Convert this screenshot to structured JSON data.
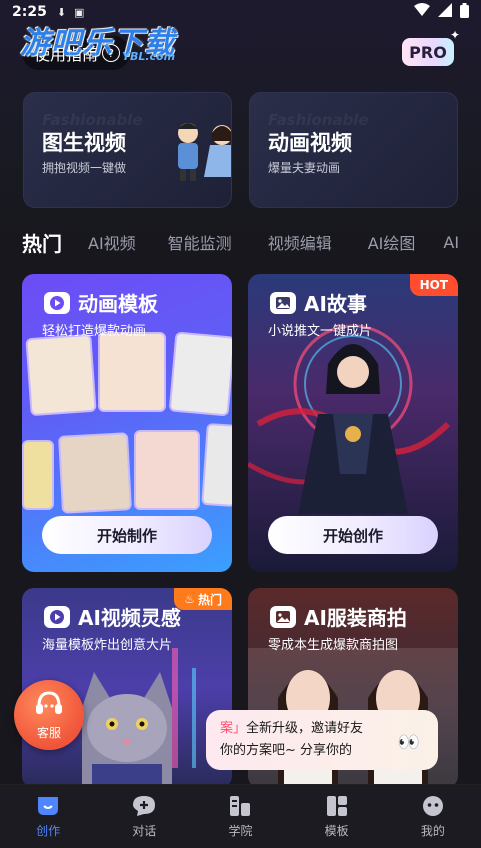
{
  "status": {
    "time": "2:25"
  },
  "watermark": {
    "title": "游吧乐下载",
    "sub": "YBL.com"
  },
  "header": {
    "guide_label": "使用指南",
    "pro_label": "PRO"
  },
  "features": [
    {
      "title": "图生视频",
      "subtitle": "拥抱视频一键做",
      "ghost": "Fashionable"
    },
    {
      "title": "动画视频",
      "subtitle": "爆量夫妻动画",
      "ghost": "Fashionable"
    }
  ],
  "tabs": [
    {
      "label": "热门"
    },
    {
      "label": "AI视频"
    },
    {
      "label": "智能监测"
    },
    {
      "label": "视频编辑"
    },
    {
      "label": "AI绘图"
    },
    {
      "label": "AI"
    }
  ],
  "cards": [
    {
      "title": "动画模板",
      "subtitle": "轻松打造爆款动画",
      "cta": "开始制作"
    },
    {
      "title": "AI故事",
      "subtitle": "小说推文一键成片",
      "cta": "开始创作",
      "badge": "HOT"
    },
    {
      "title": "AI视频灵感",
      "subtitle": "海量模板炸出创意大片",
      "badge": "热门"
    },
    {
      "title": "AI服装商拍",
      "subtitle": "零成本生成爆款商拍图"
    }
  ],
  "support": {
    "label": "客服"
  },
  "toast": {
    "line1_prefix": "案」",
    "line1": "全新升级，邀请好友",
    "line2": "你的方案吧~  分享你的"
  },
  "nav": [
    {
      "label": "创作",
      "active": true,
      "icon": "create-icon"
    },
    {
      "label": "对话",
      "active": false,
      "icon": "chat-icon"
    },
    {
      "label": "学院",
      "active": false,
      "icon": "academy-icon"
    },
    {
      "label": "模板",
      "active": false,
      "icon": "template-icon"
    },
    {
      "label": "我的",
      "active": false,
      "icon": "profile-icon"
    }
  ],
  "colors": {
    "accent": "#4f86ff",
    "hot_badge": "#ff4d2e",
    "hot_badge2": "#ff7a1a"
  }
}
